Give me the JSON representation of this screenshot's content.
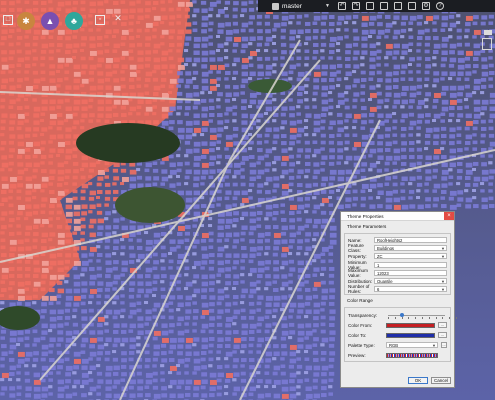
{
  "toolbar": {
    "branch": "master",
    "left_tools": [
      {
        "icon": "pin-icon",
        "color": "#c9853f"
      },
      {
        "icon": "tree-icon",
        "color": "#7a4fb0"
      },
      {
        "icon": "teal-tree-icon",
        "color": "#2fa79b"
      }
    ]
  },
  "map": {
    "theme_colors": {
      "building_low": "#7b7bd6",
      "building_high": "#ef6f63",
      "vegetation": "#2f4a2a",
      "road": "#c9c6c2"
    }
  },
  "dialog": {
    "title": "Theme Properties",
    "close_label": "×",
    "params_title": "Theme Parameters",
    "fields": [
      {
        "label": "Name:",
        "value": "RoofHeights2",
        "dropdown": false
      },
      {
        "label": "Feature Class:",
        "value": "Buildings",
        "dropdown": true
      },
      {
        "label": "Property:",
        "value": "ZC",
        "dropdown": true
      },
      {
        "label": "Minimum Value:",
        "value": "1",
        "dropdown": false
      },
      {
        "label": "Maximum Value:",
        "value": "12023",
        "dropdown": false
      },
      {
        "label": "Distribution:",
        "value": "Quantile",
        "dropdown": true
      },
      {
        "label": "Number of Rules:",
        "value": "6",
        "dropdown": true
      }
    ],
    "color_range_title": "Color Range",
    "transparency_label": "Transparency:",
    "transparency_value": 0.2,
    "color_from_label": "Color From:",
    "color_from": "#c41e22",
    "color_to_label": "Color To:",
    "color_to": "#1f2ea8",
    "palette_label": "Palette Type:",
    "palette_value": "RGB",
    "preview_label": "Preview:",
    "ellipsis": "...",
    "ok_label": "OK",
    "cancel_label": "Cancel"
  }
}
